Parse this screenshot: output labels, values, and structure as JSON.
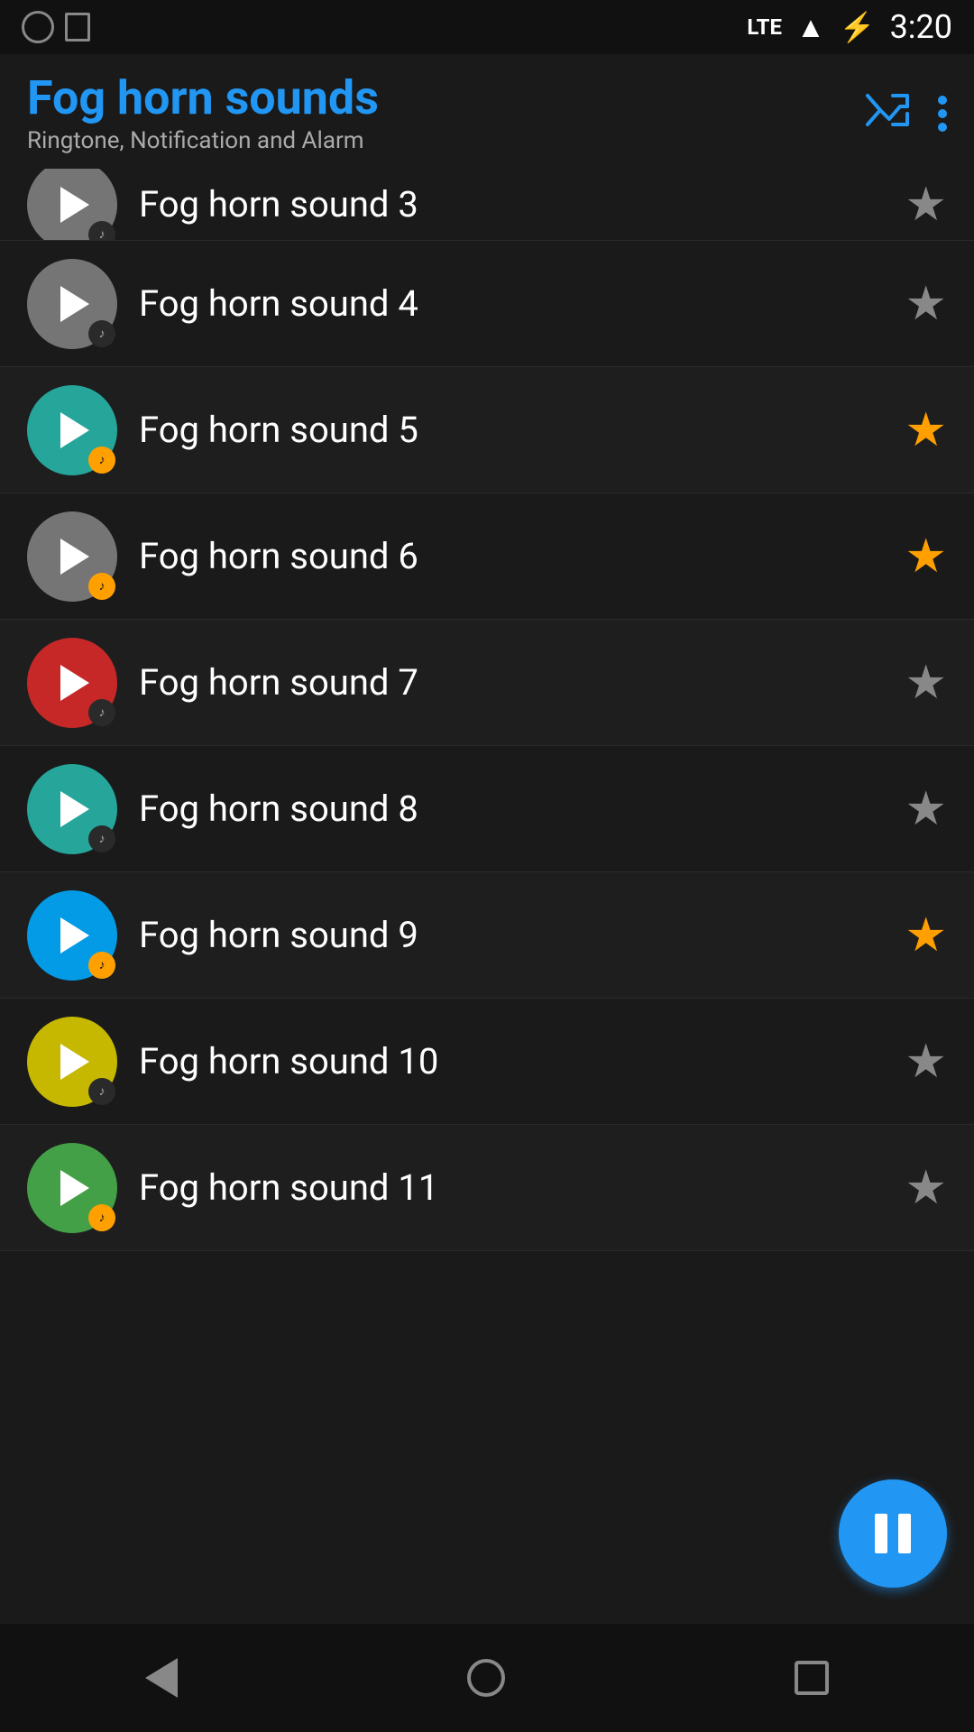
{
  "statusBar": {
    "time": "3:20",
    "lte": "LTE"
  },
  "header": {
    "title": "Fog horn sounds",
    "subtitle": "Ringtone, Notification and Alarm",
    "shuffleLabel": "shuffle",
    "moreLabel": "more options"
  },
  "sounds": [
    {
      "id": 3,
      "name": "Fog horn sound 3",
      "buttonColor": "#757575",
      "badgeColor": "#2a2a2a",
      "badgeYellow": false,
      "favorited": false,
      "partial": true
    },
    {
      "id": 4,
      "name": "Fog horn sound 4",
      "buttonColor": "#757575",
      "badgeColor": "#2a2a2a",
      "badgeYellow": false,
      "favorited": false,
      "partial": false
    },
    {
      "id": 5,
      "name": "Fog horn sound 5",
      "buttonColor": "#26A69A",
      "badgeColor": "#FFA000",
      "badgeYellow": true,
      "favorited": true,
      "partial": false
    },
    {
      "id": 6,
      "name": "Fog horn sound 6",
      "buttonColor": "#757575",
      "badgeColor": "#FFA000",
      "badgeYellow": true,
      "favorited": true,
      "partial": false
    },
    {
      "id": 7,
      "name": "Fog horn sound 7",
      "buttonColor": "#C62828",
      "badgeColor": "#2a2a2a",
      "badgeYellow": false,
      "favorited": false,
      "partial": false
    },
    {
      "id": 8,
      "name": "Fog horn sound 8",
      "buttonColor": "#26A69A",
      "badgeColor": "#2a2a2a",
      "badgeYellow": false,
      "favorited": false,
      "partial": false
    },
    {
      "id": 9,
      "name": "Fog horn sound 9",
      "buttonColor": "#039BE5",
      "badgeColor": "#FFA000",
      "badgeYellow": true,
      "favorited": true,
      "partial": false
    },
    {
      "id": 10,
      "name": "Fog horn sound 10",
      "buttonColor": "#C6B800",
      "badgeColor": "#2a2a2a",
      "badgeYellow": false,
      "favorited": false,
      "partial": false
    },
    {
      "id": 11,
      "name": "Fog horn sound 11",
      "buttonColor": "#43A047",
      "badgeColor": "#FFA000",
      "badgeYellow": true,
      "favorited": false,
      "partial": false
    }
  ],
  "bottomNav": {
    "backLabel": "back",
    "homeLabel": "home",
    "recentLabel": "recent"
  }
}
